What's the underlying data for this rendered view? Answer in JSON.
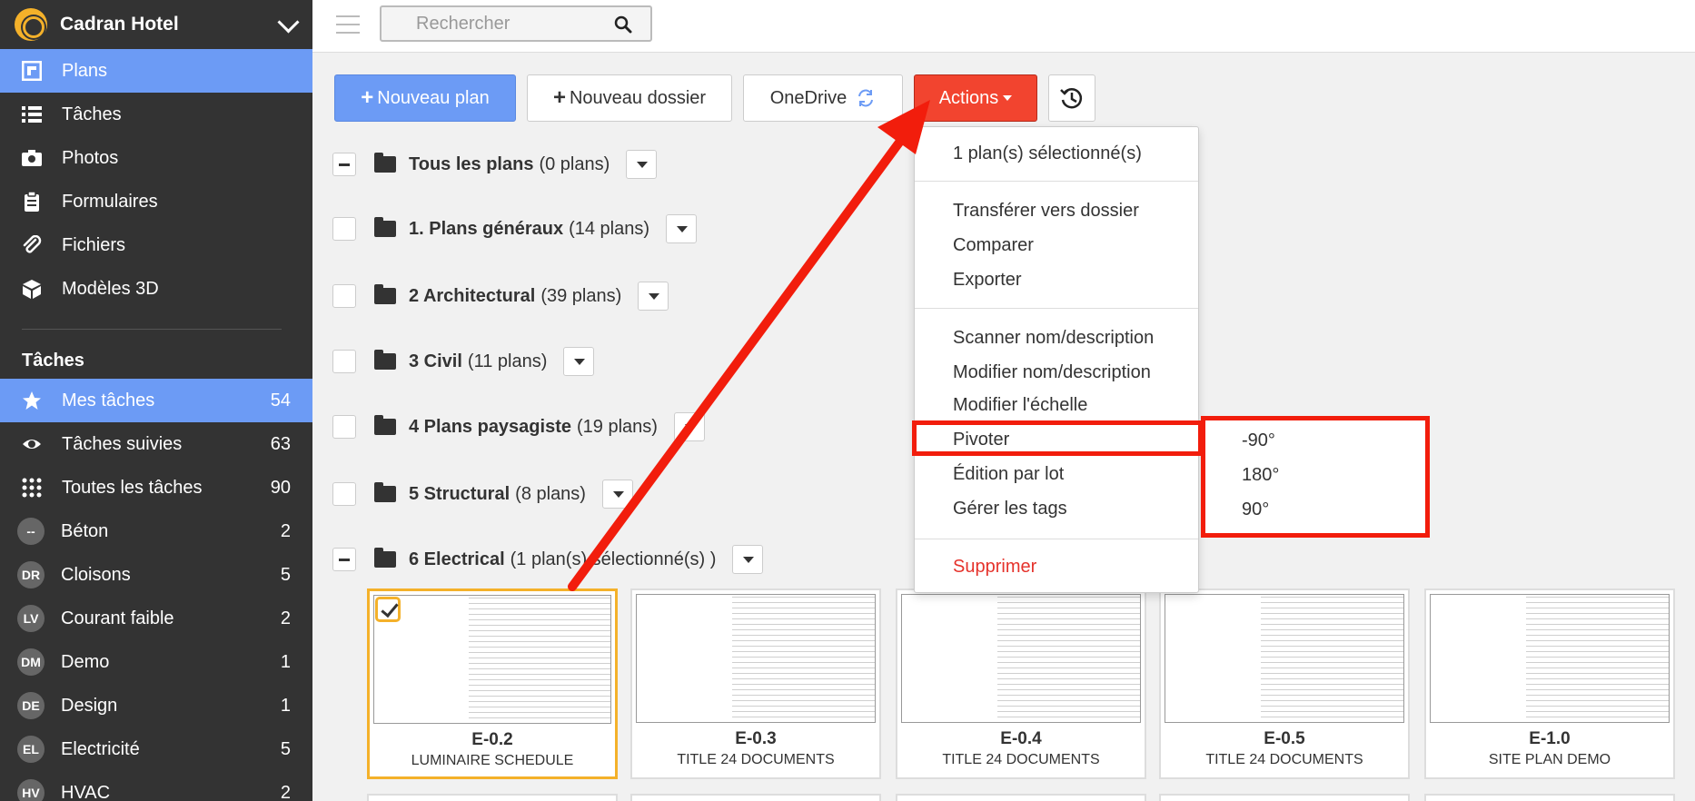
{
  "sidebar": {
    "brand": "Cadran Hotel",
    "nav": [
      {
        "label": "Plans",
        "icon": "plans-icon",
        "active": true
      },
      {
        "label": "Tâches",
        "icon": "list-icon",
        "active": false
      },
      {
        "label": "Photos",
        "icon": "camera-icon",
        "active": false
      },
      {
        "label": "Formulaires",
        "icon": "clipboard-icon",
        "active": false
      },
      {
        "label": "Fichiers",
        "icon": "paperclip-icon",
        "active": false
      },
      {
        "label": "Modèles 3D",
        "icon": "cube-icon",
        "active": false
      }
    ],
    "tasks_heading": "Tâches",
    "tasks": [
      {
        "label": "Mes tâches",
        "count": "54",
        "icon": "star-icon",
        "active": true
      },
      {
        "label": "Tâches suivies",
        "count": "63",
        "icon": "eye-icon"
      },
      {
        "label": "Toutes les tâches",
        "count": "90",
        "icon": "grid-icon"
      },
      {
        "badge": "--",
        "label": "Béton",
        "count": "2"
      },
      {
        "badge": "DR",
        "label": "Cloisons",
        "count": "5"
      },
      {
        "badge": "LV",
        "label": "Courant faible",
        "count": "2"
      },
      {
        "badge": "DM",
        "label": "Demo",
        "count": "1"
      },
      {
        "badge": "DE",
        "label": "Design",
        "count": "1"
      },
      {
        "badge": "EL",
        "label": "Electricité",
        "count": "5"
      },
      {
        "badge": "HV",
        "label": "HVAC",
        "count": "2"
      }
    ]
  },
  "topbar": {
    "search_placeholder": "Rechercher"
  },
  "toolbar": {
    "new_plan": "Nouveau plan",
    "new_folder": "Nouveau dossier",
    "onedrive": "OneDrive",
    "actions": "Actions"
  },
  "folders": [
    {
      "name": "Tous les plans",
      "count": "(0 plans)"
    },
    {
      "name": "1. Plans généraux",
      "count": "(14 plans)"
    },
    {
      "name": "2 Architectural",
      "count": "(39 plans)"
    },
    {
      "name": "3 Civil",
      "count": "(11 plans)"
    },
    {
      "name": "4 Plans paysagiste",
      "count": "(19 plans)"
    },
    {
      "name": "5 Structural",
      "count": "(8 plans)"
    },
    {
      "name": "6 Electrical",
      "count": "(1 plan(s) sélectionné(s) )"
    }
  ],
  "plans": [
    {
      "code": "E-0.2",
      "name": "LUMINAIRE SCHEDULE",
      "selected": true
    },
    {
      "code": "E-0.3",
      "name": "TITLE 24 DOCUMENTS"
    },
    {
      "code": "E-0.4",
      "name": "TITLE 24 DOCUMENTS"
    },
    {
      "code": "E-0.5",
      "name": "TITLE 24 DOCUMENTS"
    },
    {
      "code": "E-1.0",
      "name": "SITE PLAN DEMO"
    }
  ],
  "menu": {
    "selected_info": "1 plan(s) sélectionné(s)",
    "transfer": "Transférer vers dossier",
    "compare": "Comparer",
    "export": "Exporter",
    "scan": "Scanner nom/description",
    "edit_name": "Modifier nom/description",
    "edit_scale": "Modifier l'échelle",
    "rotate": "Pivoter",
    "batch": "Édition par lot",
    "tags": "Gérer les tags",
    "delete": "Supprimer"
  },
  "rotate_submenu": [
    "-90°",
    "180°",
    "90°"
  ],
  "colors": {
    "accent": "#6c9bf5",
    "danger": "#f2442f",
    "highlight": "#f21d0c",
    "selection": "#f4b12a"
  }
}
